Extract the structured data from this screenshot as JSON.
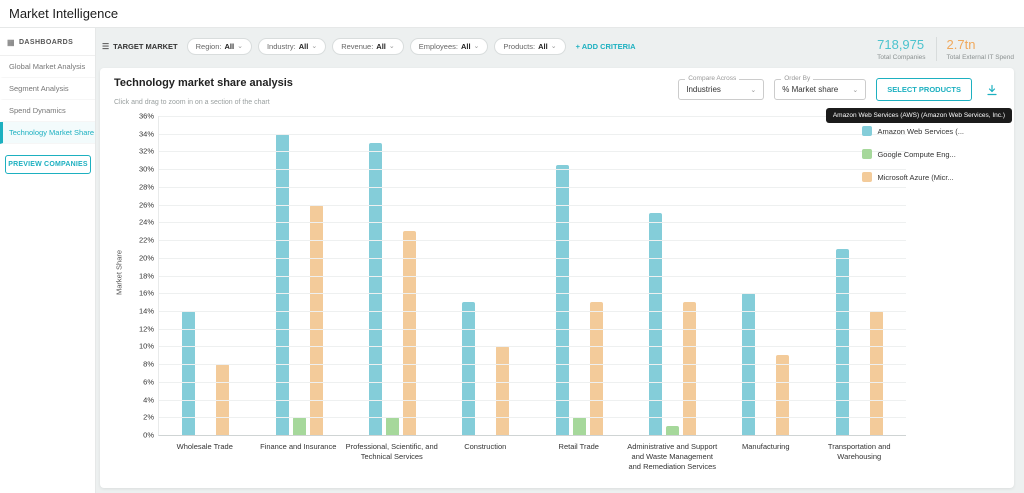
{
  "header": {
    "title": "Market Intelligence"
  },
  "icons": {
    "dashboards_icon": "▦",
    "menu_icon": "☰",
    "chevron_down": "⌄",
    "download_icon": "download-arrow"
  },
  "colors": {
    "accent": "#1db0c0",
    "companies_stat": "#4cc3ce",
    "spend_stat": "#f0a95d"
  },
  "sidebar": {
    "section_label": "DASHBOARDS",
    "items": [
      {
        "label": "Global Market Analysis",
        "active": false
      },
      {
        "label": "Segment Analysis",
        "active": false
      },
      {
        "label": "Spend Dynamics",
        "active": false
      },
      {
        "label": "Technology Market Share",
        "active": true
      }
    ],
    "preview_button": "PREVIEW COMPANIES"
  },
  "filter_bar": {
    "target_market_label": "TARGET MARKET",
    "chips": [
      {
        "label": "Region:",
        "value": "All"
      },
      {
        "label": "Industry:",
        "value": "All"
      },
      {
        "label": "Revenue:",
        "value": "All"
      },
      {
        "label": "Employees:",
        "value": "All"
      },
      {
        "label": "Products:",
        "value": "All"
      }
    ],
    "add_criteria": "+ ADD CRITERIA",
    "stats": [
      {
        "value": "718,975",
        "label": "Total Companies",
        "color": "#4cc3ce"
      },
      {
        "value": "2.7tn",
        "label": "Total External IT Spend",
        "color": "#f0a95d"
      }
    ]
  },
  "chart_card": {
    "title": "Technology market share analysis",
    "subtitle": "Click and drag to zoom in on a section of the chart",
    "compare_across": {
      "label": "Compare Across",
      "value": "Industries"
    },
    "order_by": {
      "label": "Order By",
      "value": "% Market share"
    },
    "select_products": "SELECT PRODUCTS",
    "tooltip": "Amazon Web Services (AWS) (Amazon Web Services, Inc.)"
  },
  "chart_data": {
    "type": "bar",
    "title": "Technology market share analysis",
    "xlabel": "",
    "ylabel": "Market Share",
    "ylim": [
      0,
      36
    ],
    "ytick_step": 2,
    "grid": true,
    "legend_position": "top-right",
    "categories": [
      "Wholesale Trade",
      "Finance and Insurance",
      "Professional, Scientific, and Technical Services",
      "Construction",
      "Retail Trade",
      "Administrative and Support and Waste Management and Remediation Services",
      "Manufacturing",
      "Transportation and Warehousing"
    ],
    "series": [
      {
        "name": "Amazon Web Services (...",
        "color": "#84cdd9",
        "values": [
          14,
          34,
          33,
          15,
          30.5,
          25,
          16,
          21
        ]
      },
      {
        "name": "Google Compute Eng...",
        "color": "#a6d89b",
        "values": [
          0,
          2,
          2,
          0,
          2,
          1,
          0,
          0
        ]
      },
      {
        "name": "Microsoft Azure (Micr...",
        "color": "#f3cb9a",
        "values": [
          8,
          26,
          23,
          10,
          15,
          15,
          9,
          14
        ]
      }
    ]
  }
}
